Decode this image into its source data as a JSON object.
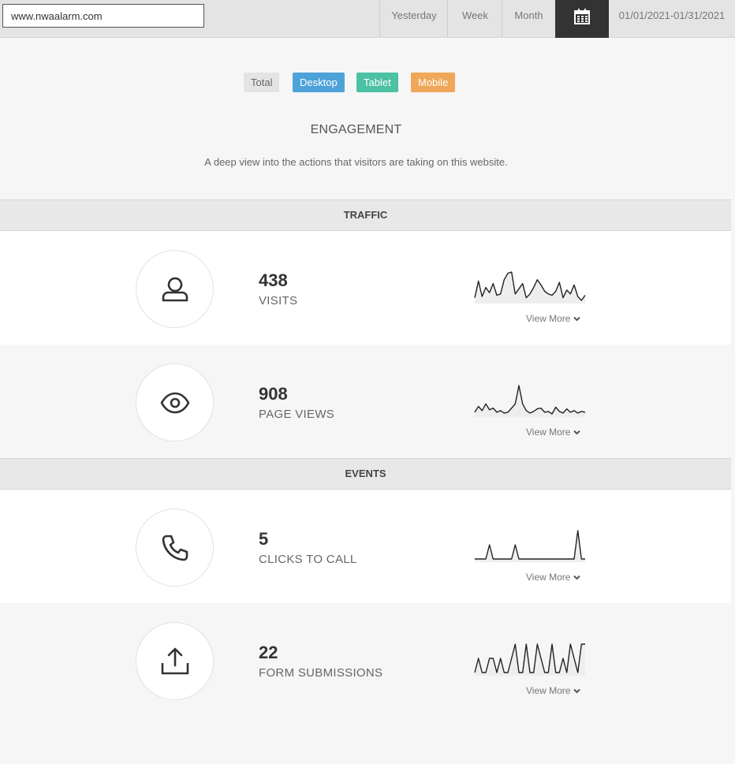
{
  "header": {
    "site_value": "www.nwaalarm.com",
    "yesterday_label": "Yesterday",
    "week_label": "Week",
    "month_label": "Month",
    "calendar_icon": "calendar-icon",
    "date_range": "01/01/2021-01/31/2021"
  },
  "legend": {
    "total": "Total",
    "desktop": "Desktop",
    "tablet": "Tablet",
    "mobile": "Mobile",
    "colors": {
      "total": "#e4e4e4",
      "desktop": "#4da3d9",
      "tablet": "#4cc1a4",
      "mobile": "#f0a75a"
    }
  },
  "engagement": {
    "title": "ENGAGEMENT",
    "description": "A deep view into the actions that visitors are taking on this website."
  },
  "groups": {
    "traffic": "TRAFFIC",
    "events": "EVENTS"
  },
  "metrics": [
    {
      "icon": "user-icon",
      "value": "438",
      "label": "VISITS",
      "view_more": "View More",
      "trend": [
        12,
        25,
        13,
        20,
        16,
        23,
        14,
        15,
        26,
        31,
        32,
        15,
        19,
        23,
        12,
        15,
        20,
        26,
        22,
        17,
        15,
        14,
        17,
        24,
        12,
        18,
        15,
        22,
        13,
        10,
        14
      ]
    },
    {
      "icon": "eye-icon",
      "value": "908",
      "label": "PAGE VIEWS",
      "view_more": "View More",
      "trend": [
        5,
        12,
        7,
        15,
        8,
        10,
        5,
        7,
        4,
        5,
        10,
        15,
        37,
        15,
        7,
        4,
        6,
        9,
        10,
        5,
        6,
        3,
        11,
        6,
        4,
        9,
        5,
        7,
        4,
        6,
        5
      ]
    },
    {
      "icon": "phone-icon",
      "value": "5",
      "label": "CLICKS TO CALL",
      "view_more": "View More",
      "trend": [
        0,
        0,
        0,
        0,
        1,
        0,
        0,
        0,
        0,
        0,
        0,
        1,
        0,
        0,
        0,
        0,
        0,
        0,
        0,
        0,
        0,
        0,
        0,
        0,
        0,
        0,
        0,
        0,
        2,
        0,
        0
      ]
    },
    {
      "icon": "upload-icon",
      "value": "22",
      "label": "FORM SUBMISSIONS",
      "view_more": "View More",
      "trend": [
        0,
        1,
        0,
        0,
        1,
        1,
        0,
        1,
        0,
        0,
        1,
        2,
        0,
        0,
        2,
        0,
        0,
        2,
        1,
        0,
        0,
        2,
        0,
        0,
        1,
        0,
        2,
        1,
        0,
        2,
        2
      ]
    }
  ]
}
